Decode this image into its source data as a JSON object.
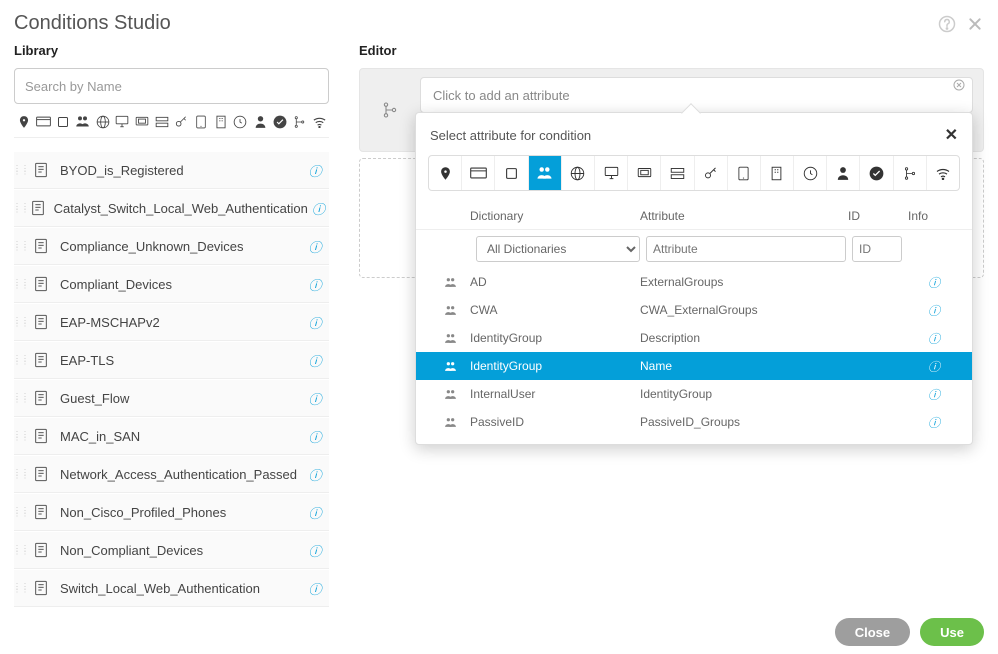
{
  "title": "Conditions Studio",
  "library": {
    "heading": "Library",
    "search_placeholder": "Search by Name",
    "items": [
      {
        "label": "BYOD_is_Registered"
      },
      {
        "label": "Catalyst_Switch_Local_Web_Authentication"
      },
      {
        "label": "Compliance_Unknown_Devices"
      },
      {
        "label": "Compliant_Devices"
      },
      {
        "label": "EAP-MSCHAPv2"
      },
      {
        "label": "EAP-TLS"
      },
      {
        "label": "Guest_Flow"
      },
      {
        "label": "MAC_in_SAN"
      },
      {
        "label": "Network_Access_Authentication_Passed"
      },
      {
        "label": "Non_Cisco_Profiled_Phones"
      },
      {
        "label": "Non_Compliant_Devices"
      },
      {
        "label": "Switch_Local_Web_Authentication"
      }
    ]
  },
  "editor": {
    "heading": "Editor",
    "input_placeholder": "Click to add an attribute"
  },
  "popover": {
    "title": "Select attribute for condition",
    "headers": {
      "dict": "Dictionary",
      "attr": "Attribute",
      "id": "ID",
      "info": "Info"
    },
    "filters": {
      "dict_selected": "All Dictionaries",
      "attr_placeholder": "Attribute",
      "id_placeholder": "ID"
    },
    "rows": [
      {
        "dict": "AD",
        "attr": "ExternalGroups",
        "selected": false
      },
      {
        "dict": "CWA",
        "attr": "CWA_ExternalGroups",
        "selected": false
      },
      {
        "dict": "IdentityGroup",
        "attr": "Description",
        "selected": false
      },
      {
        "dict": "IdentityGroup",
        "attr": "Name",
        "selected": true
      },
      {
        "dict": "InternalUser",
        "attr": "IdentityGroup",
        "selected": false
      },
      {
        "dict": "PassiveID",
        "attr": "PassiveID_Groups",
        "selected": false
      }
    ]
  },
  "footer": {
    "close": "Close",
    "use": "Use"
  }
}
